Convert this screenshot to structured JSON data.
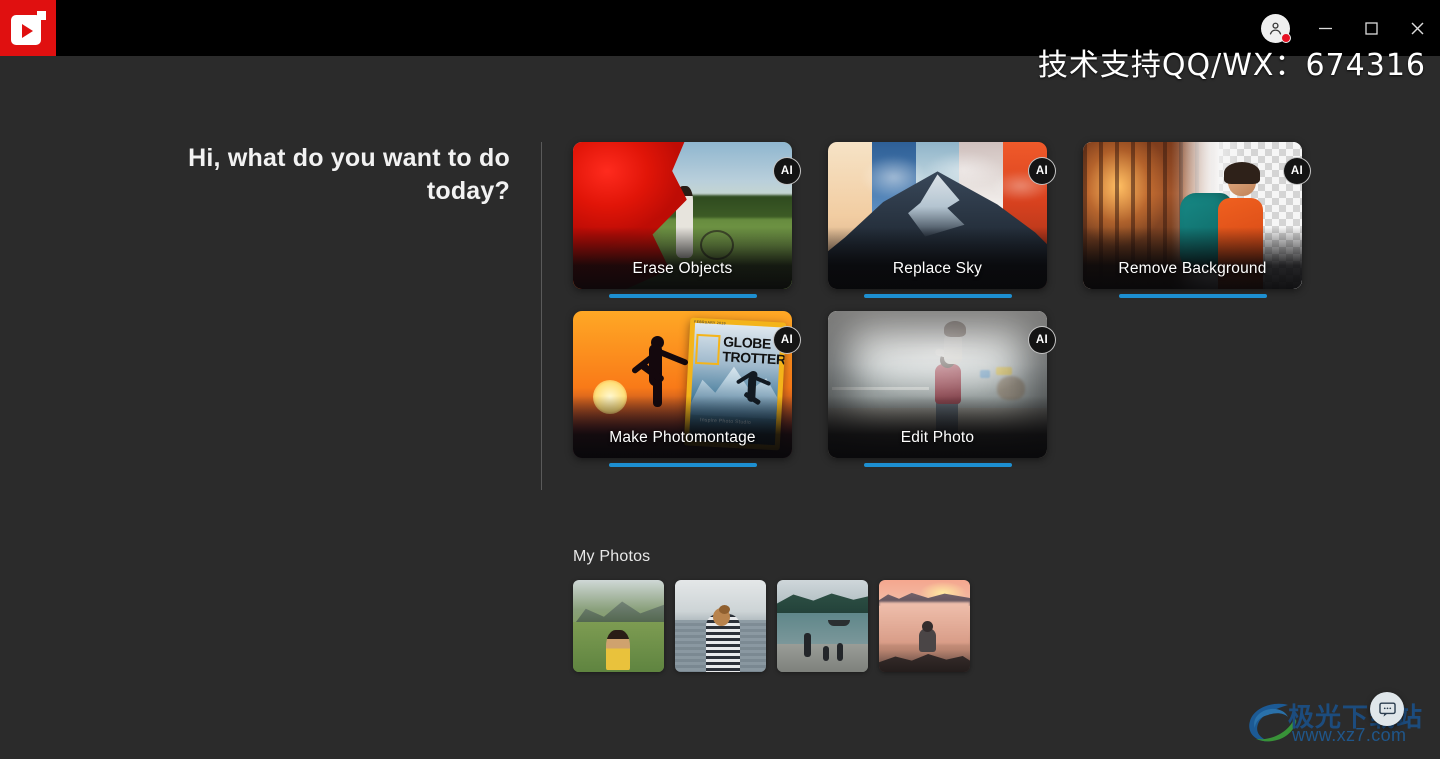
{
  "app": {
    "logo_icon": "play-logo-icon",
    "brand_color": "#e01010"
  },
  "titlebar": {
    "avatar_icon": "user-avatar-icon",
    "avatar_badge_color": "#e81123",
    "minimize_icon": "minimize-icon",
    "maximize_icon": "maximize-icon",
    "close_icon": "close-icon"
  },
  "watermarks": {
    "support": "技术支持QQ/WX：674316",
    "site_name": "极光下载站",
    "site_url": "www.xz7.com"
  },
  "main": {
    "greeting": "Hi, what do you want to do today?",
    "accent_color": "#1d8fd1",
    "cards": [
      {
        "label": "Erase Objects",
        "badge": "AI"
      },
      {
        "label": "Replace Sky",
        "badge": "AI"
      },
      {
        "label": "Remove Background",
        "badge": "AI"
      },
      {
        "label": "Make Photomontage",
        "badge": "AI"
      },
      {
        "label": "Edit Photo",
        "badge": "AI"
      }
    ],
    "montage_magazine": {
      "title_line1": "GLOBE",
      "title_line2": "TROTTER",
      "kicker": "FEBRUARY 2019",
      "caption": "Inspire Photo Studio"
    }
  },
  "photos": {
    "title": "My Photos",
    "items": [
      {
        "name": "mountain-hiker-thumbnail"
      },
      {
        "name": "woman-at-lake-thumbnail"
      },
      {
        "name": "shore-people-thumbnail"
      },
      {
        "name": "sunset-clouds-thumbnail"
      }
    ]
  },
  "fab": {
    "icon": "chat-bubble-icon"
  }
}
